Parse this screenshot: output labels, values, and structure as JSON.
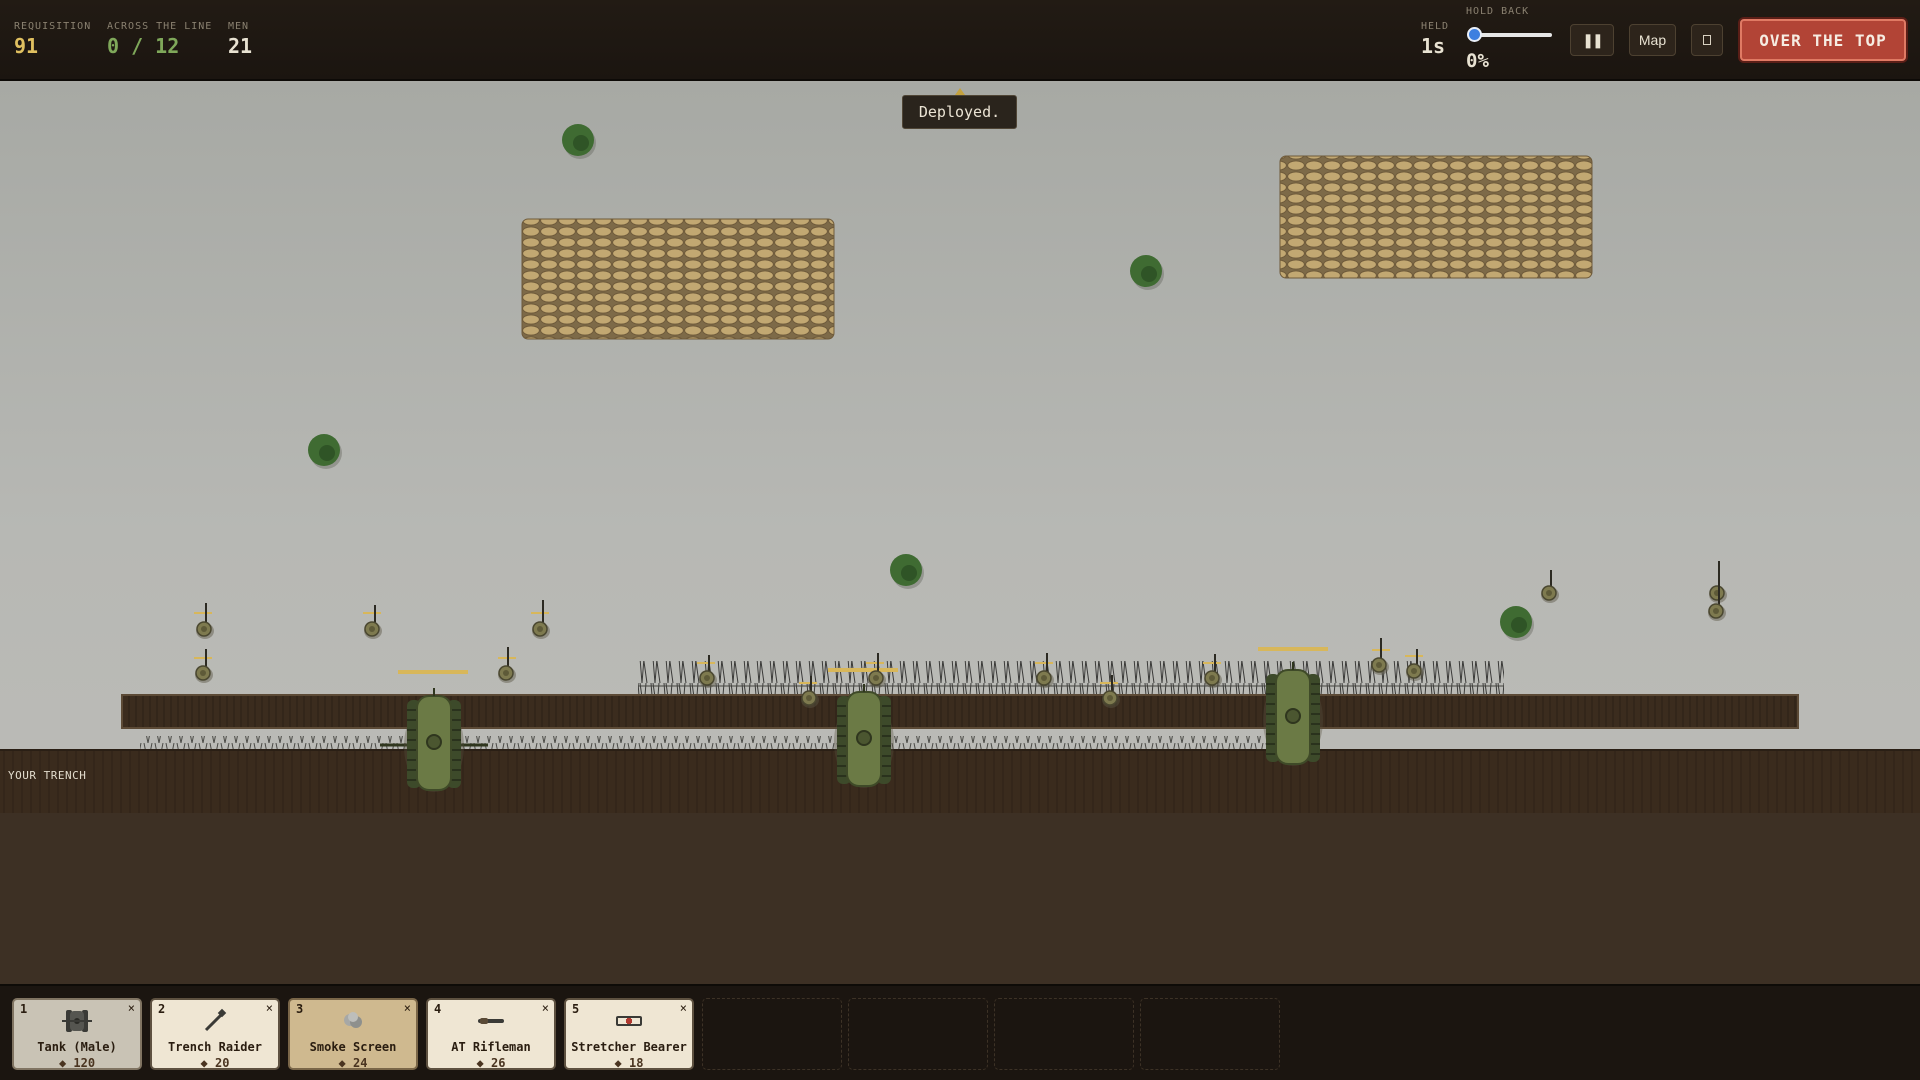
{
  "hud": {
    "requisition": {
      "label": "REQUISITION",
      "value": "91"
    },
    "across": {
      "label": "ACROSS THE LINE",
      "value": "0 / 12"
    },
    "men": {
      "label": "MEN",
      "value": "21"
    },
    "held": {
      "label": "HELD",
      "value": "1s"
    },
    "hold_back": {
      "label": "HOLD BACK",
      "value": "0%",
      "level": 0
    },
    "pause_label": "❚❚",
    "map_label": "Map",
    "over_the_top_label": "OVER THE TOP"
  },
  "toast": "Deployed.",
  "trench_label": "YOUR TRENCH",
  "colors": {
    "tank": "#6b7a45",
    "soldier": "#7e7a4f",
    "sandbag": "#c2a872",
    "mud": "#3d2e1f",
    "tree": "#3f6b32",
    "accent": "#b24436"
  },
  "deploy_cards": [
    {
      "slot": "1",
      "name": "Tank (Male)",
      "cost": "◆ 120",
      "icon": "tank-icon",
      "style": "selected"
    },
    {
      "slot": "2",
      "name": "Trench Raider",
      "cost": "◆ 20",
      "icon": "raider-icon",
      "style": "normal"
    },
    {
      "slot": "3",
      "name": "Smoke Screen",
      "cost": "◆ 24",
      "icon": "smoke-icon",
      "style": "dim"
    },
    {
      "slot": "4",
      "name": "AT Rifleman",
      "cost": "◆ 26",
      "icon": "rifle-icon",
      "style": "normal"
    },
    {
      "slot": "5",
      "name": "Stretcher Bearer",
      "cost": "◆ 18",
      "icon": "stretcher-icon",
      "style": "normal"
    }
  ],
  "remove_glyph": "×"
}
